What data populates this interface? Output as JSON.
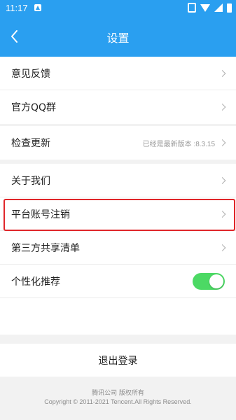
{
  "status_bar": {
    "time": "11:17"
  },
  "nav": {
    "title": "设置"
  },
  "group1": [
    {
      "label": "意见反馈"
    },
    {
      "label": "官方QQ群"
    }
  ],
  "group2": [
    {
      "label": "检查更新",
      "value": "已经是最新版本 :8.3.15"
    }
  ],
  "group3": [
    {
      "label": "关于我们"
    },
    {
      "label": "平台账号注销"
    },
    {
      "label": "第三方共享清单"
    },
    {
      "label": "个性化推荐",
      "toggle_on": true
    }
  ],
  "logout": {
    "label": "退出登录"
  },
  "footer": {
    "line1": "腾讯公司 版权所有",
    "line2": "Copyright © 2011-2021 Tencent.All Rights Reserved."
  },
  "colors": {
    "accent": "#2a9ff0",
    "toggle_on": "#4cd964",
    "highlight": "#e0262a"
  }
}
